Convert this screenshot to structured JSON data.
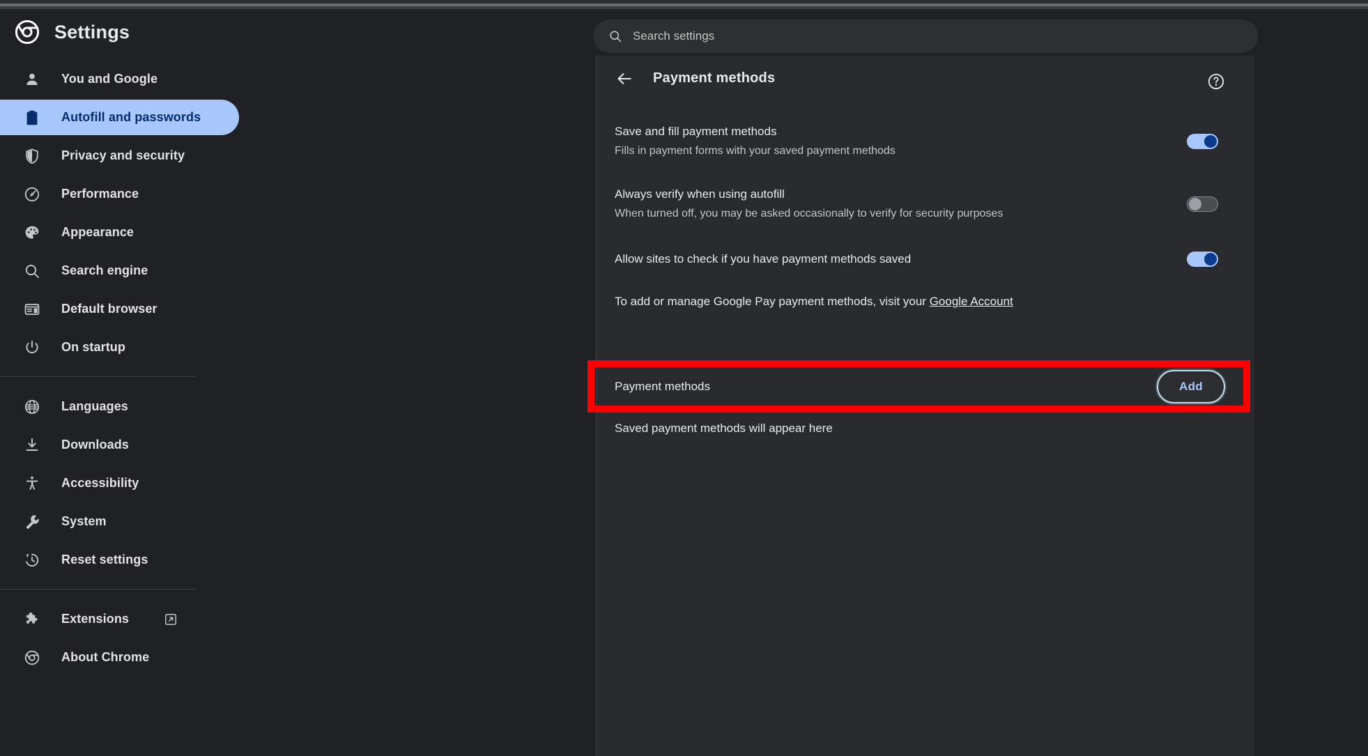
{
  "window": {
    "bg_color": "#202124",
    "panel_color": "#292a2d"
  },
  "header": {
    "logo_icon": "chrome-logo-icon",
    "title": "Settings",
    "search": {
      "icon": "search-icon",
      "placeholder": "Search settings",
      "value": ""
    }
  },
  "sidebar": {
    "groups": [
      {
        "items": [
          {
            "label": "You and Google",
            "icon": "person-icon",
            "selected": false
          },
          {
            "label": "Autofill and passwords",
            "icon": "clipboard-icon",
            "selected": true
          },
          {
            "label": "Privacy and security",
            "icon": "shield-icon",
            "selected": false
          },
          {
            "label": "Performance",
            "icon": "speedometer-icon",
            "selected": false
          },
          {
            "label": "Appearance",
            "icon": "palette-icon",
            "selected": false
          },
          {
            "label": "Search engine",
            "icon": "search-icon",
            "selected": false
          },
          {
            "label": "Default browser",
            "icon": "browser-window-icon",
            "selected": false
          },
          {
            "label": "On startup",
            "icon": "power-icon",
            "selected": false
          }
        ]
      },
      {
        "items": [
          {
            "label": "Languages",
            "icon": "globe-icon",
            "selected": false
          },
          {
            "label": "Downloads",
            "icon": "download-icon",
            "selected": false
          },
          {
            "label": "Accessibility",
            "icon": "accessibility-icon",
            "selected": false
          },
          {
            "label": "System",
            "icon": "wrench-icon",
            "selected": false
          },
          {
            "label": "Reset settings",
            "icon": "history-icon",
            "selected": false
          }
        ]
      },
      {
        "items": [
          {
            "label": "Extensions",
            "icon": "puzzle-icon",
            "selected": false,
            "external": true,
            "external_icon": "external-link-icon"
          },
          {
            "label": "About Chrome",
            "icon": "chrome-logo-icon",
            "selected": false,
            "external": false
          }
        ]
      }
    ],
    "selected_colors": {
      "pill": "#a8c7fa",
      "text": "#062e6f"
    }
  },
  "main": {
    "back_icon": "back-arrow-icon",
    "title": "Payment methods",
    "help_icon": "help-circle-icon",
    "settings": [
      {
        "title": "Save and fill payment methods",
        "subtitle": "Fills in payment forms with your saved payment methods",
        "toggle": "on"
      },
      {
        "title": "Always verify when using autofill",
        "subtitle": "When turned off, you may be asked occasionally to verify for security purposes",
        "toggle": "off"
      },
      {
        "title": "Allow sites to check if you have payment methods saved",
        "subtitle": "",
        "toggle": "on"
      }
    ],
    "google_pay_note": {
      "prefix": "To add or manage Google Pay payment methods, visit your ",
      "link_label": "Google Account"
    },
    "payment_methods_row": {
      "label": "Payment methods",
      "add_label": "Add",
      "highlighted": true,
      "highlight_color": "#fe0000"
    },
    "empty_state": "Saved payment methods will appear here"
  }
}
